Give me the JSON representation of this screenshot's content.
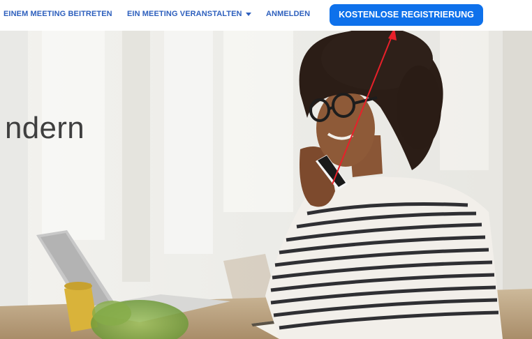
{
  "nav": {
    "join_label": "EINEM MEETING BEITRETEN",
    "host_label": "EIN MEETING VERANSTALTEN",
    "signin_label": "ANMELDEN",
    "signup_label": "KOSTENLOSE REGISTRIERUNG"
  },
  "hero": {
    "heading_fragment": "ndern",
    "image_icon": "woman-on-phone-photo"
  },
  "annotation": {
    "color": "#e8202a",
    "icon": "arrow-icon"
  },
  "colors": {
    "link": "#2d5fbd",
    "primary_button": "#0e71eb"
  }
}
